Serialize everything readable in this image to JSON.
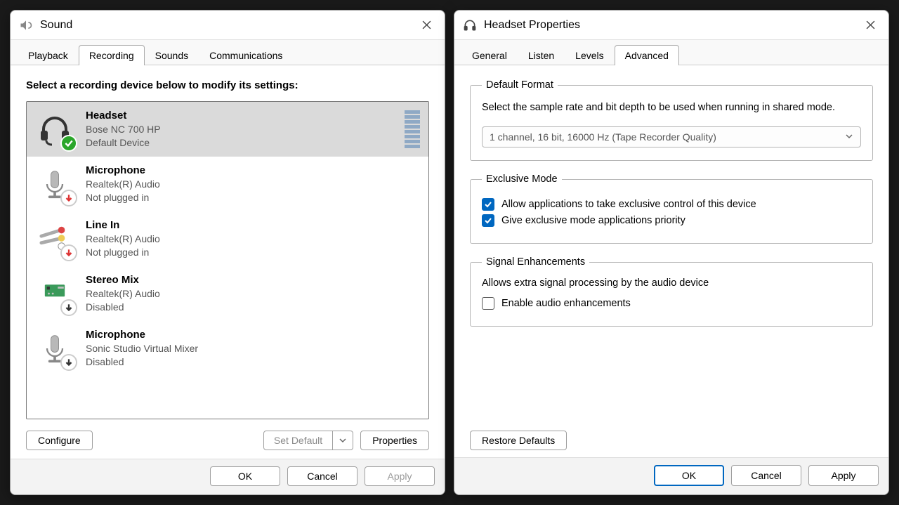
{
  "sound_window": {
    "title": "Sound",
    "tabs": [
      "Playback",
      "Recording",
      "Sounds",
      "Communications"
    ],
    "active_tab_index": 1,
    "instruction": "Select a recording device below to modify its settings:",
    "devices": [
      {
        "name": "Headset",
        "sub": "Bose NC 700 HP",
        "status": "Default Device",
        "selected": true,
        "badge": "ok",
        "show_levels": true
      },
      {
        "name": "Microphone",
        "sub": "Realtek(R) Audio",
        "status": "Not plugged in",
        "selected": false,
        "badge": "unplugged",
        "show_levels": false
      },
      {
        "name": "Line In",
        "sub": "Realtek(R) Audio",
        "status": "Not plugged in",
        "selected": false,
        "badge": "unplugged",
        "show_levels": false
      },
      {
        "name": "Stereo Mix",
        "sub": "Realtek(R) Audio",
        "status": "Disabled",
        "selected": false,
        "badge": "disabled",
        "show_levels": false
      },
      {
        "name": "Microphone",
        "sub": "Sonic Studio Virtual Mixer",
        "status": "Disabled",
        "selected": false,
        "badge": "disabled",
        "show_levels": false
      }
    ],
    "configure_btn": "Configure",
    "set_default_btn": "Set Default",
    "properties_btn": "Properties",
    "ok_btn": "OK",
    "cancel_btn": "Cancel",
    "apply_btn": "Apply"
  },
  "properties_window": {
    "title": "Headset Properties",
    "tabs": [
      "General",
      "Listen",
      "Levels",
      "Advanced"
    ],
    "active_tab_index": 3,
    "default_format": {
      "legend": "Default Format",
      "desc": "Select the sample rate and bit depth to be used when running in shared mode.",
      "value": "1 channel, 16 bit, 16000 Hz (Tape Recorder Quality)"
    },
    "exclusive": {
      "legend": "Exclusive Mode",
      "opt1": "Allow applications to take exclusive control of this device",
      "opt2": "Give exclusive mode applications priority",
      "opt1_checked": true,
      "opt2_checked": true
    },
    "signal": {
      "legend": "Signal Enhancements",
      "desc": "Allows extra signal processing by the audio device",
      "opt": "Enable audio enhancements",
      "opt_checked": false
    },
    "restore_btn": "Restore Defaults",
    "ok_btn": "OK",
    "cancel_btn": "Cancel",
    "apply_btn": "Apply"
  }
}
